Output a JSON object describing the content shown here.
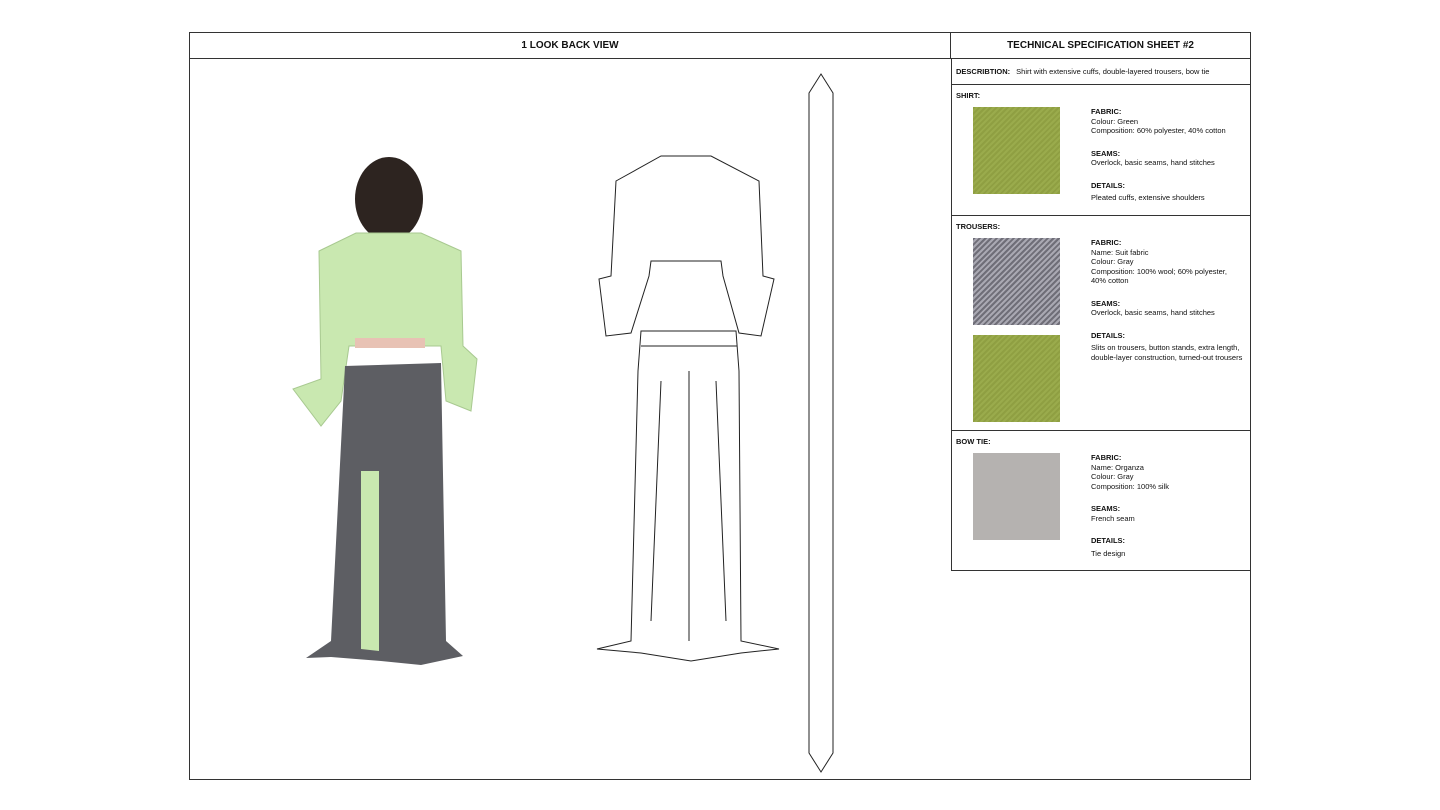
{
  "left_header": "1 LOOK BACK VIEW",
  "right_header": "TECHNICAL SPECIFICATION SHEET #2",
  "description": {
    "label": "DESCRIBTION:",
    "text": "Shirt with extensive cuffs, double-layered trousers, bow tie"
  },
  "shirt": {
    "title": "SHIRT:",
    "fabric_label": "FABRIC:",
    "fabric": [
      "Colour: Green",
      "Composition: 60% polyester, 40% cotton"
    ],
    "seams_label": "SEAMS:",
    "seams": "Overlock, basic seams, hand stitches",
    "details_label": "DETAILS:",
    "details": "Pleated cuffs, extensive shoulders"
  },
  "trousers": {
    "title": "TROUSERS:",
    "fabric_label": "FABRIC:",
    "fabric": [
      "Name: Suit fabric",
      "Colour: Gray",
      "Composition: 100% wool; 60% polyester,",
      "40% cotton"
    ],
    "seams_label": "SEAMS:",
    "seams": "Overlock, basic seams, hand stitches",
    "details_label": "DETAILS:",
    "details": [
      "Slits on trousers, button stands, extra length,",
      "double-layer construction, turned-out trousers"
    ]
  },
  "bowtie": {
    "title": "BOW TIE:",
    "fabric_label": "FABRIC:",
    "fabric": [
      "Name: Organza",
      "Colour: Gray",
      "Composition: 100% silk"
    ],
    "seams_label": "SEAMS:",
    "seams": "French seam",
    "details_label": "DETAILS:",
    "details": "Tie design"
  },
  "colors": {
    "shirt_green": "#c9e8b0",
    "fabric_green": "#94a547",
    "trouser_gray": "#5d5e63"
  }
}
